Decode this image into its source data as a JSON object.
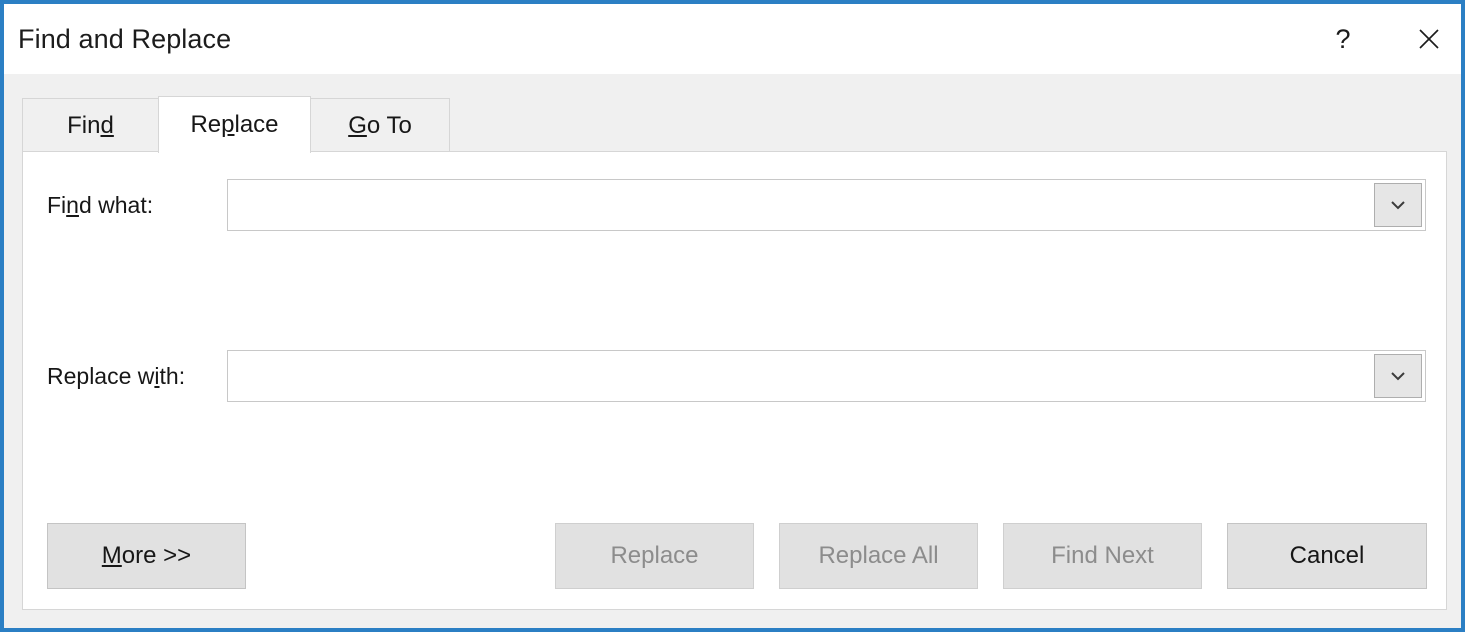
{
  "window": {
    "title": "Find and Replace",
    "help_label": "?",
    "close_label": "✕",
    "border_color": "#2b7fc4",
    "titlebar_bg": "#ffffff",
    "dialog_bg": "#f0f0f0",
    "panel_bg": "#ffffff"
  },
  "tabs": [
    {
      "id": "find",
      "label_before": "Fin",
      "accel": "d",
      "label_after": "",
      "active": false
    },
    {
      "id": "replace",
      "label_before": "Re",
      "accel": "p",
      "label_after": "lace",
      "active": true
    },
    {
      "id": "goto",
      "label_before": "",
      "accel": "G",
      "label_after": "o To",
      "active": false
    }
  ],
  "fields": {
    "find_what": {
      "label_before": "Fi",
      "accel": "n",
      "label_after": "d what:",
      "value": "",
      "placeholder": "",
      "dropdown_icon": "chevron-down-icon"
    },
    "replace_with": {
      "label_before": "Replace w",
      "accel": "i",
      "label_after": "th:",
      "value": "",
      "placeholder": "",
      "dropdown_icon": "chevron-down-icon"
    }
  },
  "buttons": [
    {
      "id": "more",
      "label_before": "",
      "accel": "M",
      "label_after": "ore >>",
      "enabled": true
    },
    {
      "id": "replace",
      "label_before": "Replace",
      "accel": "",
      "label_after": "",
      "enabled": false
    },
    {
      "id": "replace_all",
      "label_before": "Replace All",
      "accel": "",
      "label_after": "",
      "enabled": false
    },
    {
      "id": "find_next",
      "label_before": "Find Next",
      "accel": "",
      "label_after": "",
      "enabled": false
    },
    {
      "id": "cancel",
      "label_before": "Cancel",
      "accel": "",
      "label_after": "",
      "enabled": true
    }
  ],
  "colors": {
    "accent_border": "#2b7fc4",
    "text_enabled": "#171717",
    "text_disabled": "#8c8c8c",
    "button_face": "#e1e1e1",
    "field_border": "#c8c8c8"
  }
}
